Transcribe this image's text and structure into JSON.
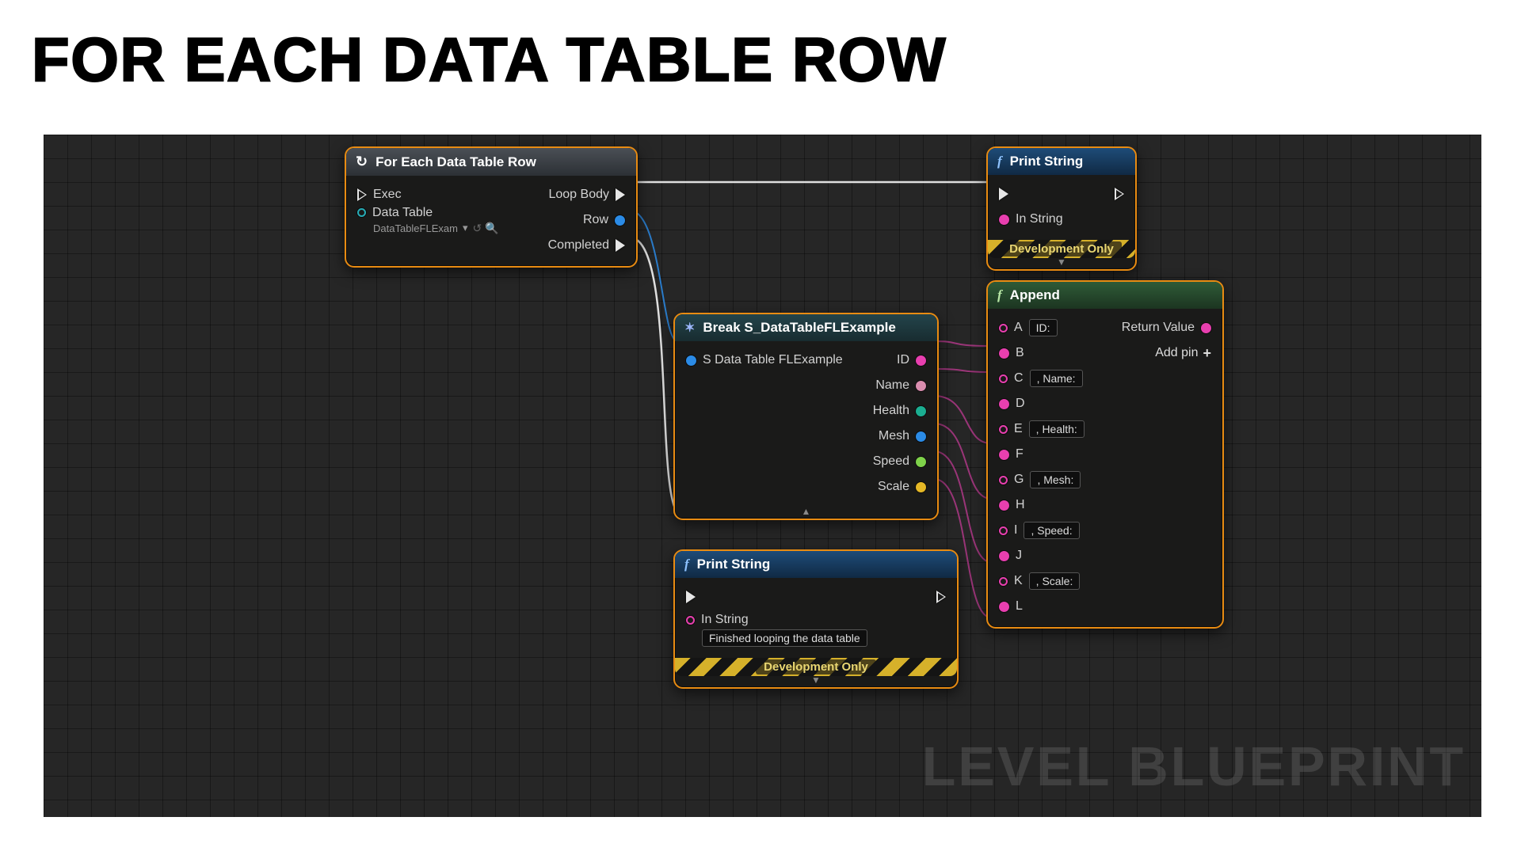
{
  "title": "FOR EACH DATA TABLE ROW",
  "watermark": "LEVEL BLUEPRINT",
  "nodes": {
    "foreach": {
      "title": "For Each Data Table Row",
      "exec_in": "Exec",
      "loop_body": "Loop Body",
      "data_table_label": "Data Table",
      "data_table_value": "DataTableFLExam",
      "row": "Row",
      "completed": "Completed"
    },
    "break": {
      "title": "Break S_DataTableFLExample",
      "input": "S Data Table FLExample",
      "outputs": {
        "id": "ID",
        "name": "Name",
        "health": "Health",
        "mesh": "Mesh",
        "speed": "Speed",
        "scale": "Scale"
      }
    },
    "print1": {
      "title": "Print String",
      "in_string": "In String",
      "dev_only": "Development Only"
    },
    "print2": {
      "title": "Print String",
      "in_string_label": "In String",
      "in_string_value": "Finished looping the data table",
      "dev_only": "Development Only"
    },
    "append": {
      "title": "Append",
      "return_value": "Return Value",
      "add_pin": "Add pin",
      "pins": {
        "a": {
          "label": "A",
          "value": "ID:"
        },
        "b": {
          "label": "B"
        },
        "c": {
          "label": "C",
          "value": ", Name:"
        },
        "d": {
          "label": "D"
        },
        "e": {
          "label": "E",
          "value": ", Health:"
        },
        "f": {
          "label": "F"
        },
        "g": {
          "label": "G",
          "value": ", Mesh:"
        },
        "h": {
          "label": "H"
        },
        "i": {
          "label": "I",
          "value": ", Speed:"
        },
        "j": {
          "label": "J"
        },
        "k": {
          "label": "K",
          "value": ", Scale:"
        },
        "l": {
          "label": "L"
        }
      }
    }
  }
}
